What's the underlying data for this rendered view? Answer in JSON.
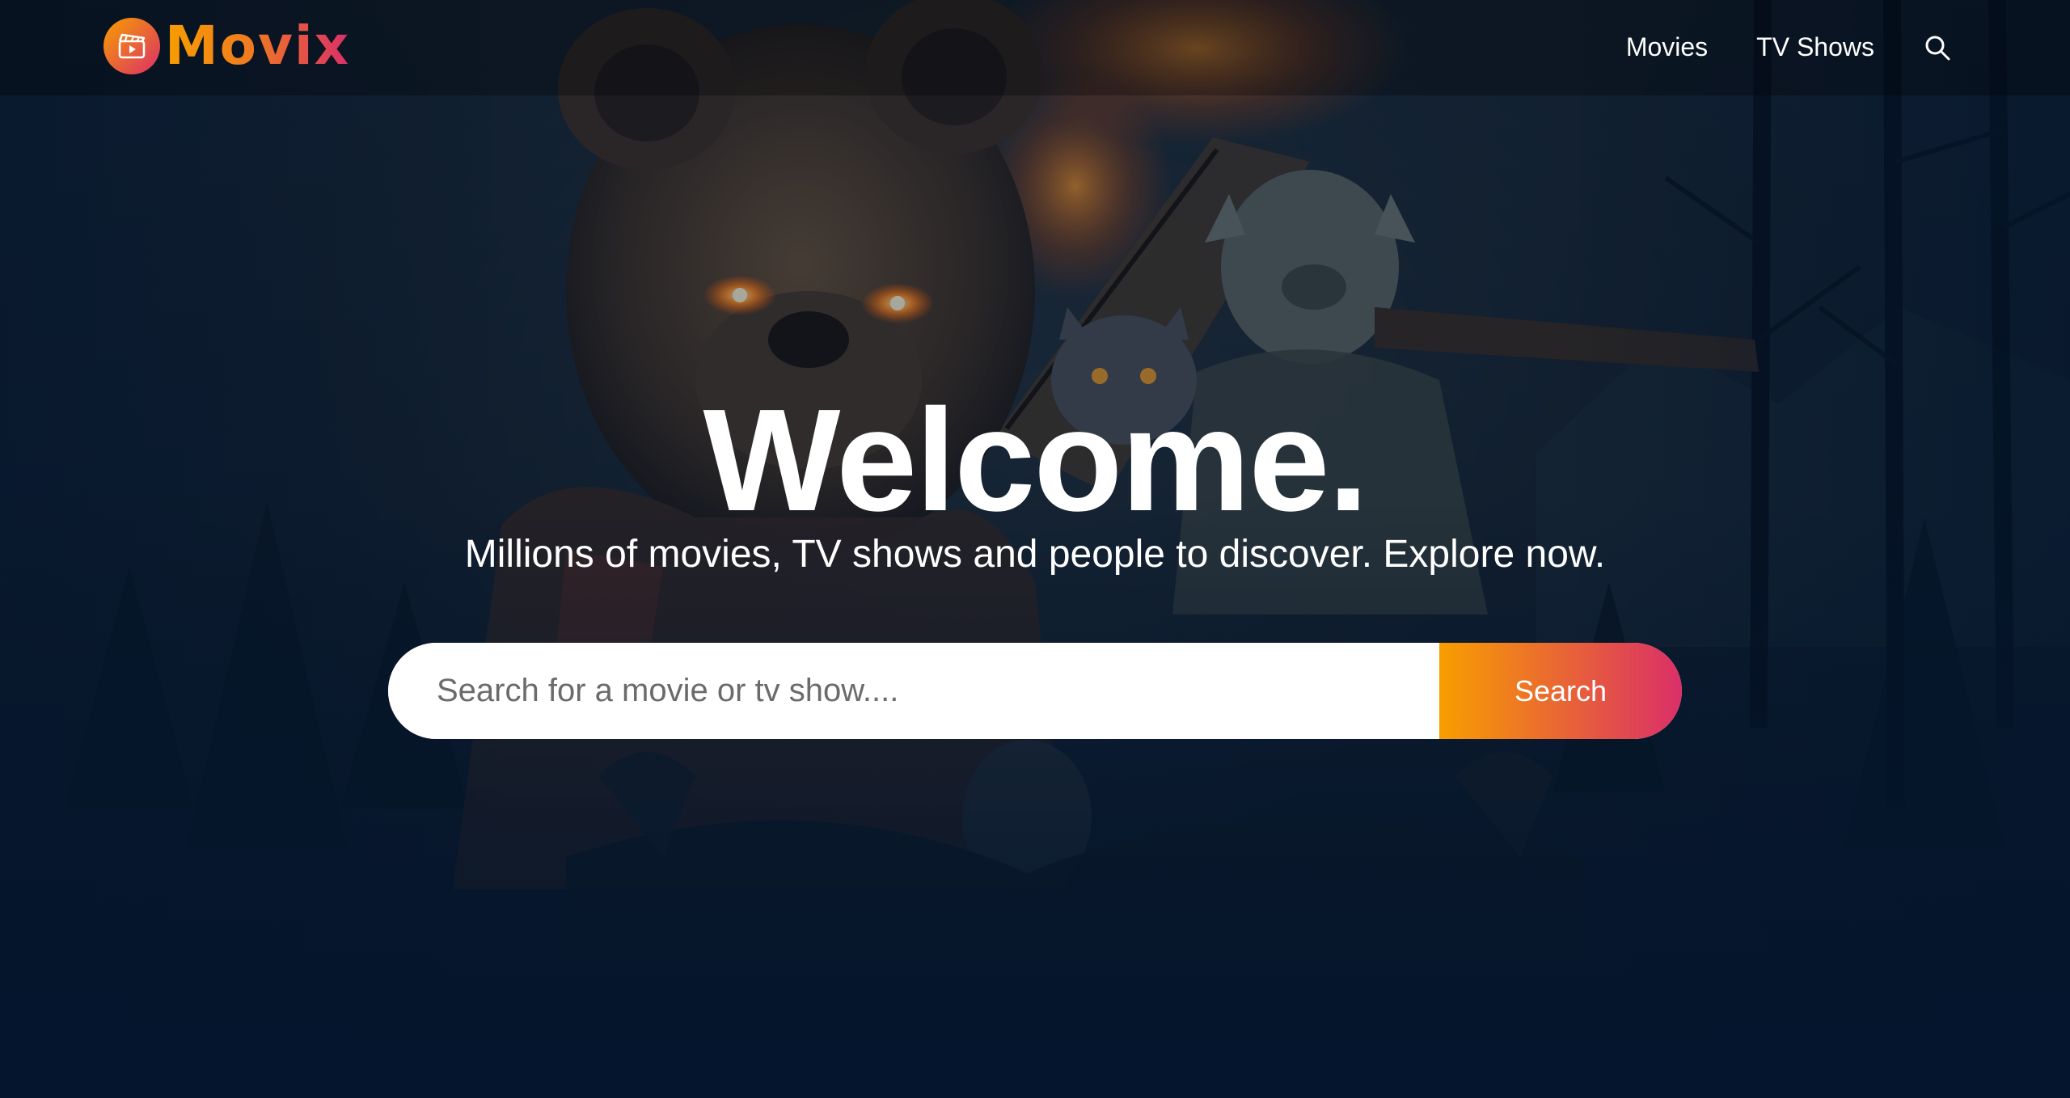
{
  "app": {
    "logo_text": "Movix"
  },
  "icons": {
    "logo": "clapperboard-play-icon",
    "nav_search": "search-icon"
  },
  "nav": {
    "items": [
      {
        "label": "Movies"
      },
      {
        "label": "TV Shows"
      }
    ]
  },
  "hero": {
    "title": "Welcome.",
    "subtitle": "Millions of movies, TV shows and people to discover. Explore now.",
    "search": {
      "placeholder": "Search for a movie or tv show....",
      "value": "",
      "button_label": "Search"
    }
  },
  "colors": {
    "background": "#04152d",
    "gradient_start": "#f89e00",
    "gradient_end": "#da2f68",
    "text": "#ffffff"
  }
}
